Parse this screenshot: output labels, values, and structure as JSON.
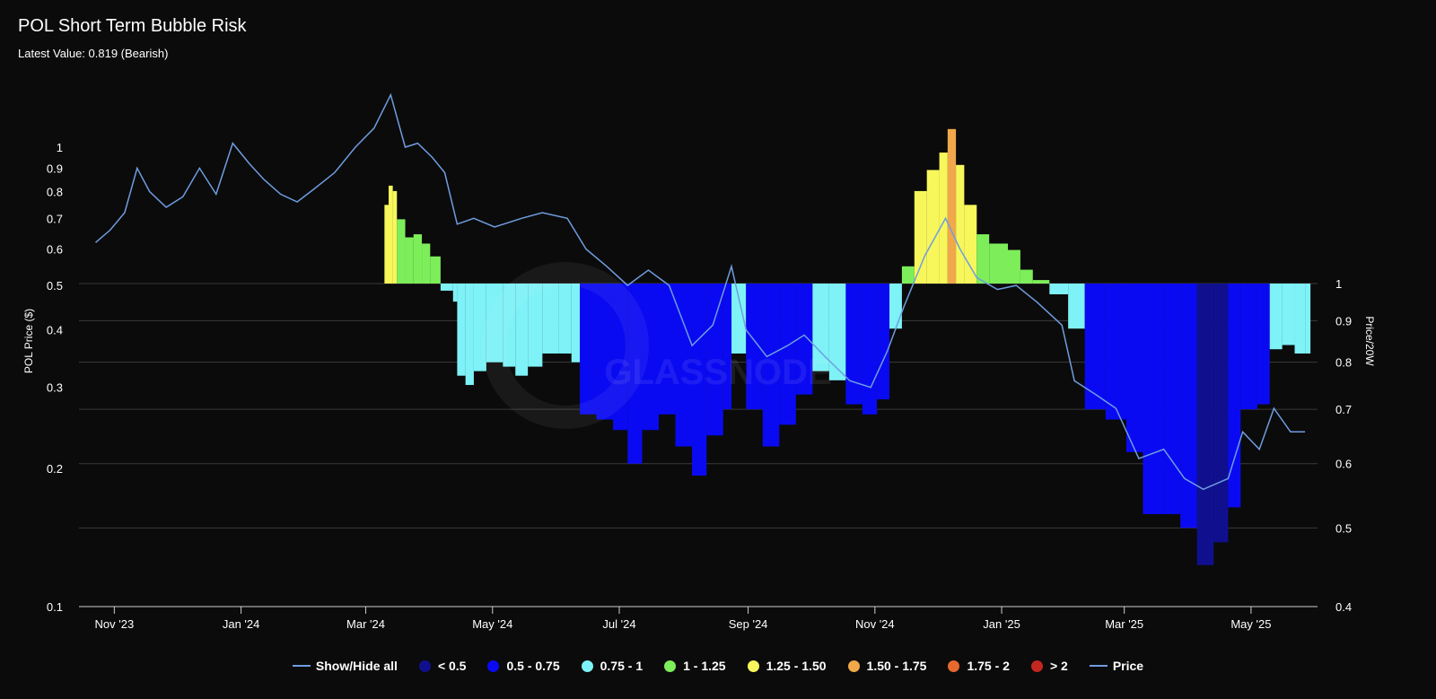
{
  "header": {
    "title": "POL Short Term Bubble Risk",
    "subtitle": "Latest Value: 0.819 (Bearish)"
  },
  "watermark": "GLASSNODE",
  "legend": {
    "show_hide_all": "Show/Hide all",
    "items": [
      {
        "label": "< 0.5",
        "color": "#10108f"
      },
      {
        "label": "0.5 - 0.75",
        "color": "#0a0af2"
      },
      {
        "label": "0.75 - 1",
        "color": "#7ef2f7"
      },
      {
        "label": "1 - 1.25",
        "color": "#7dee5a"
      },
      {
        "label": "1.25 - 1.50",
        "color": "#f7f75c"
      },
      {
        "label": "1.50 - 1.75",
        "color": "#f0a84a"
      },
      {
        "label": "1.75 - 2",
        "color": "#e8692d"
      },
      {
        "label": "> 2",
        "color": "#c4271f"
      }
    ],
    "price_label": "Price",
    "price_color": "#6f9de0"
  },
  "chart_data": {
    "type": "line",
    "title": "POL Short Term Bubble Risk",
    "subtitle": "Latest Value: 0.819 (Bearish)",
    "x_ticks": [
      "Nov '23",
      "Jan '24",
      "Mar '24",
      "May '24",
      "Jul '24",
      "Sep '24",
      "Nov '24",
      "Jan '25",
      "Mar '25",
      "May '25"
    ],
    "y_left": {
      "label": "POL Price ($)",
      "scale": "log",
      "range": [
        0.1,
        1.4
      ],
      "ticks": [
        "0.1",
        "0.2",
        "0.3",
        "0.4",
        "0.5",
        "0.6",
        "0.7",
        "0.8",
        "0.9",
        "1"
      ]
    },
    "y_right": {
      "label": "Price/20W",
      "scale": "log",
      "range": [
        0.4,
        1.6
      ],
      "ticks": [
        "0.4",
        "0.5",
        "0.6",
        "0.7",
        "0.8",
        "0.9",
        "1"
      ]
    },
    "grid": true,
    "legend_position": "bottom",
    "series": [
      {
        "name": "Price",
        "type": "line",
        "axis": "left",
        "points": [
          [
            "2023-10-23",
            0.62
          ],
          [
            "2023-10-30",
            0.66
          ],
          [
            "2023-11-06",
            0.72
          ],
          [
            "2023-11-12",
            0.9
          ],
          [
            "2023-11-18",
            0.8
          ],
          [
            "2023-11-26",
            0.74
          ],
          [
            "2023-12-04",
            0.78
          ],
          [
            "2023-12-12",
            0.9
          ],
          [
            "2023-12-20",
            0.79
          ],
          [
            "2023-12-28",
            1.02
          ],
          [
            "2024-01-05",
            0.92
          ],
          [
            "2024-01-12",
            0.85
          ],
          [
            "2024-01-20",
            0.79
          ],
          [
            "2024-01-28",
            0.76
          ],
          [
            "2024-02-05",
            0.81
          ],
          [
            "2024-02-15",
            0.88
          ],
          [
            "2024-02-25",
            1.0
          ],
          [
            "2024-03-05",
            1.1
          ],
          [
            "2024-03-13",
            1.3
          ],
          [
            "2024-03-20",
            1.0
          ],
          [
            "2024-03-26",
            1.02
          ],
          [
            "2024-04-02",
            0.95
          ],
          [
            "2024-04-08",
            0.88
          ],
          [
            "2024-04-14",
            0.68
          ],
          [
            "2024-04-22",
            0.7
          ],
          [
            "2024-05-02",
            0.67
          ],
          [
            "2024-05-15",
            0.7
          ],
          [
            "2024-05-25",
            0.72
          ],
          [
            "2024-06-06",
            0.7
          ],
          [
            "2024-06-15",
            0.6
          ],
          [
            "2024-06-25",
            0.55
          ],
          [
            "2024-07-05",
            0.5
          ],
          [
            "2024-07-15",
            0.54
          ],
          [
            "2024-07-25",
            0.5
          ],
          [
            "2024-08-05",
            0.37
          ],
          [
            "2024-08-15",
            0.41
          ],
          [
            "2024-08-24",
            0.55
          ],
          [
            "2024-08-31",
            0.4
          ],
          [
            "2024-09-10",
            0.35
          ],
          [
            "2024-09-20",
            0.37
          ],
          [
            "2024-09-28",
            0.39
          ],
          [
            "2024-10-08",
            0.35
          ],
          [
            "2024-10-20",
            0.31
          ],
          [
            "2024-10-30",
            0.3
          ],
          [
            "2024-11-07",
            0.36
          ],
          [
            "2024-11-15",
            0.45
          ],
          [
            "2024-11-25",
            0.58
          ],
          [
            "2024-12-05",
            0.7
          ],
          [
            "2024-12-12",
            0.6
          ],
          [
            "2024-12-20",
            0.52
          ],
          [
            "2024-12-30",
            0.49
          ],
          [
            "2025-01-08",
            0.5
          ],
          [
            "2025-01-18",
            0.46
          ],
          [
            "2025-01-30",
            0.41
          ],
          [
            "2025-02-05",
            0.31
          ],
          [
            "2025-02-15",
            0.29
          ],
          [
            "2025-02-25",
            0.27
          ],
          [
            "2025-03-08",
            0.21
          ],
          [
            "2025-03-20",
            0.22
          ],
          [
            "2025-03-30",
            0.19
          ],
          [
            "2025-04-08",
            0.18
          ],
          [
            "2025-04-20",
            0.19
          ],
          [
            "2025-04-27",
            0.24
          ],
          [
            "2025-05-05",
            0.22
          ],
          [
            "2025-05-12",
            0.27
          ],
          [
            "2025-05-20",
            0.24
          ],
          [
            "2025-05-27",
            0.24
          ]
        ]
      },
      {
        "name": "Price/20W",
        "type": "bar",
        "axis": "right",
        "baseline": 1,
        "points": [
          [
            "2024-03-10",
            1.25
          ],
          [
            "2024-03-12",
            1.32
          ],
          [
            "2024-03-14",
            1.3
          ],
          [
            "2024-03-16",
            1.2
          ],
          [
            "2024-03-20",
            1.14
          ],
          [
            "2024-03-24",
            1.15
          ],
          [
            "2024-03-28",
            1.12
          ],
          [
            "2024-04-01",
            1.08
          ],
          [
            "2024-04-06",
            0.98
          ],
          [
            "2024-04-12",
            0.95
          ],
          [
            "2024-04-14",
            0.77
          ],
          [
            "2024-04-18",
            0.75
          ],
          [
            "2024-04-22",
            0.78
          ],
          [
            "2024-04-28",
            0.8
          ],
          [
            "2024-05-06",
            0.79
          ],
          [
            "2024-05-12",
            0.77
          ],
          [
            "2024-05-18",
            0.79
          ],
          [
            "2024-05-25",
            0.82
          ],
          [
            "2024-06-02",
            0.82
          ],
          [
            "2024-06-08",
            0.8
          ],
          [
            "2024-06-12",
            0.69
          ],
          [
            "2024-06-20",
            0.68
          ],
          [
            "2024-06-28",
            0.66
          ],
          [
            "2024-07-05",
            0.6
          ],
          [
            "2024-07-12",
            0.66
          ],
          [
            "2024-07-20",
            0.69
          ],
          [
            "2024-07-28",
            0.63
          ],
          [
            "2024-08-05",
            0.58
          ],
          [
            "2024-08-12",
            0.65
          ],
          [
            "2024-08-20",
            0.7
          ],
          [
            "2024-08-24",
            0.82
          ],
          [
            "2024-08-31",
            0.7
          ],
          [
            "2024-09-08",
            0.63
          ],
          [
            "2024-09-16",
            0.67
          ],
          [
            "2024-09-24",
            0.73
          ],
          [
            "2024-10-02",
            0.78
          ],
          [
            "2024-10-10",
            0.76
          ],
          [
            "2024-10-18",
            0.71
          ],
          [
            "2024-10-26",
            0.69
          ],
          [
            "2024-11-02",
            0.72
          ],
          [
            "2024-11-08",
            0.88
          ],
          [
            "2024-11-14",
            1.05
          ],
          [
            "2024-11-20",
            1.3
          ],
          [
            "2024-11-26",
            1.38
          ],
          [
            "2024-12-02",
            1.45
          ],
          [
            "2024-12-06",
            1.55
          ],
          [
            "2024-12-10",
            1.4
          ],
          [
            "2024-12-14",
            1.25
          ],
          [
            "2024-12-20",
            1.15
          ],
          [
            "2024-12-26",
            1.12
          ],
          [
            "2025-01-04",
            1.1
          ],
          [
            "2025-01-10",
            1.04
          ],
          [
            "2025-01-16",
            1.01
          ],
          [
            "2025-01-24",
            0.97
          ],
          [
            "2025-02-02",
            0.88
          ],
          [
            "2025-02-10",
            0.7
          ],
          [
            "2025-02-20",
            0.68
          ],
          [
            "2025-03-02",
            0.62
          ],
          [
            "2025-03-10",
            0.52
          ],
          [
            "2025-03-20",
            0.52
          ],
          [
            "2025-03-28",
            0.5
          ],
          [
            "2025-04-05",
            0.45
          ],
          [
            "2025-04-13",
            0.48
          ],
          [
            "2025-04-20",
            0.53
          ],
          [
            "2025-04-26",
            0.7
          ],
          [
            "2025-05-04",
            0.71
          ],
          [
            "2025-05-10",
            0.83
          ],
          [
            "2025-05-16",
            0.84
          ],
          [
            "2025-05-22",
            0.82
          ],
          [
            "2025-05-27",
            0.82
          ]
        ]
      }
    ],
    "color_bins": [
      {
        "max": 0.5,
        "color": "#10108f"
      },
      {
        "max": 0.75,
        "color": "#0a0af2"
      },
      {
        "max": 1.0,
        "color": "#7ef2f7"
      },
      {
        "max": 1.25,
        "color": "#7dee5a"
      },
      {
        "max": 1.5,
        "color": "#f7f75c"
      },
      {
        "max": 1.75,
        "color": "#f0a84a"
      },
      {
        "max": 2.0,
        "color": "#e8692d"
      },
      {
        "max": 999,
        "color": "#c4271f"
      }
    ]
  }
}
